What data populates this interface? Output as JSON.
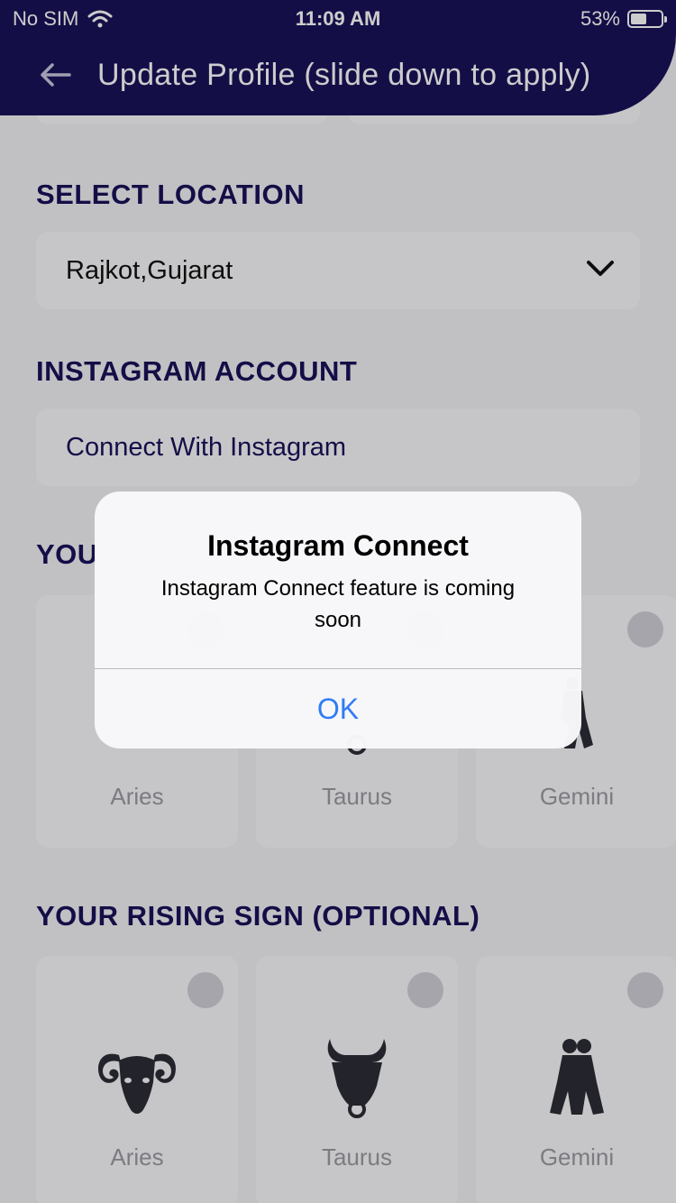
{
  "status_bar": {
    "carrier": "No SIM",
    "time": "11:09 AM",
    "battery_percent_text": "53%",
    "battery_level": 0.53
  },
  "header": {
    "title": "Update Profile (slide down to apply)",
    "background_color": "#1a1259"
  },
  "location_section": {
    "title": "SELECT LOCATION",
    "value": "Rajkot,Gujarat"
  },
  "instagram_section": {
    "title": "INSTAGRAM ACCOUNT",
    "button_label": "Connect With Instagram"
  },
  "sun_sign_section": {
    "title_visible": "YOU",
    "cards": [
      {
        "label": "Aries",
        "icon": "aries-ram-icon"
      },
      {
        "label": "Taurus",
        "icon": "taurus-bull-icon"
      },
      {
        "label": "Gemini",
        "icon": "gemini-twins-icon"
      }
    ]
  },
  "rising_sign_section": {
    "title": "YOUR RISING SIGN (OPTIONAL)",
    "cards": [
      {
        "label": "Aries",
        "icon": "aries-ram-icon"
      },
      {
        "label": "Taurus",
        "icon": "taurus-bull-icon"
      },
      {
        "label": "Gemini",
        "icon": "gemini-twins-icon"
      }
    ]
  },
  "alert": {
    "title": "Instagram Connect",
    "message": "Instagram Connect feature is coming soon",
    "ok_label": "OK",
    "ok_color": "#2f7cf6"
  }
}
